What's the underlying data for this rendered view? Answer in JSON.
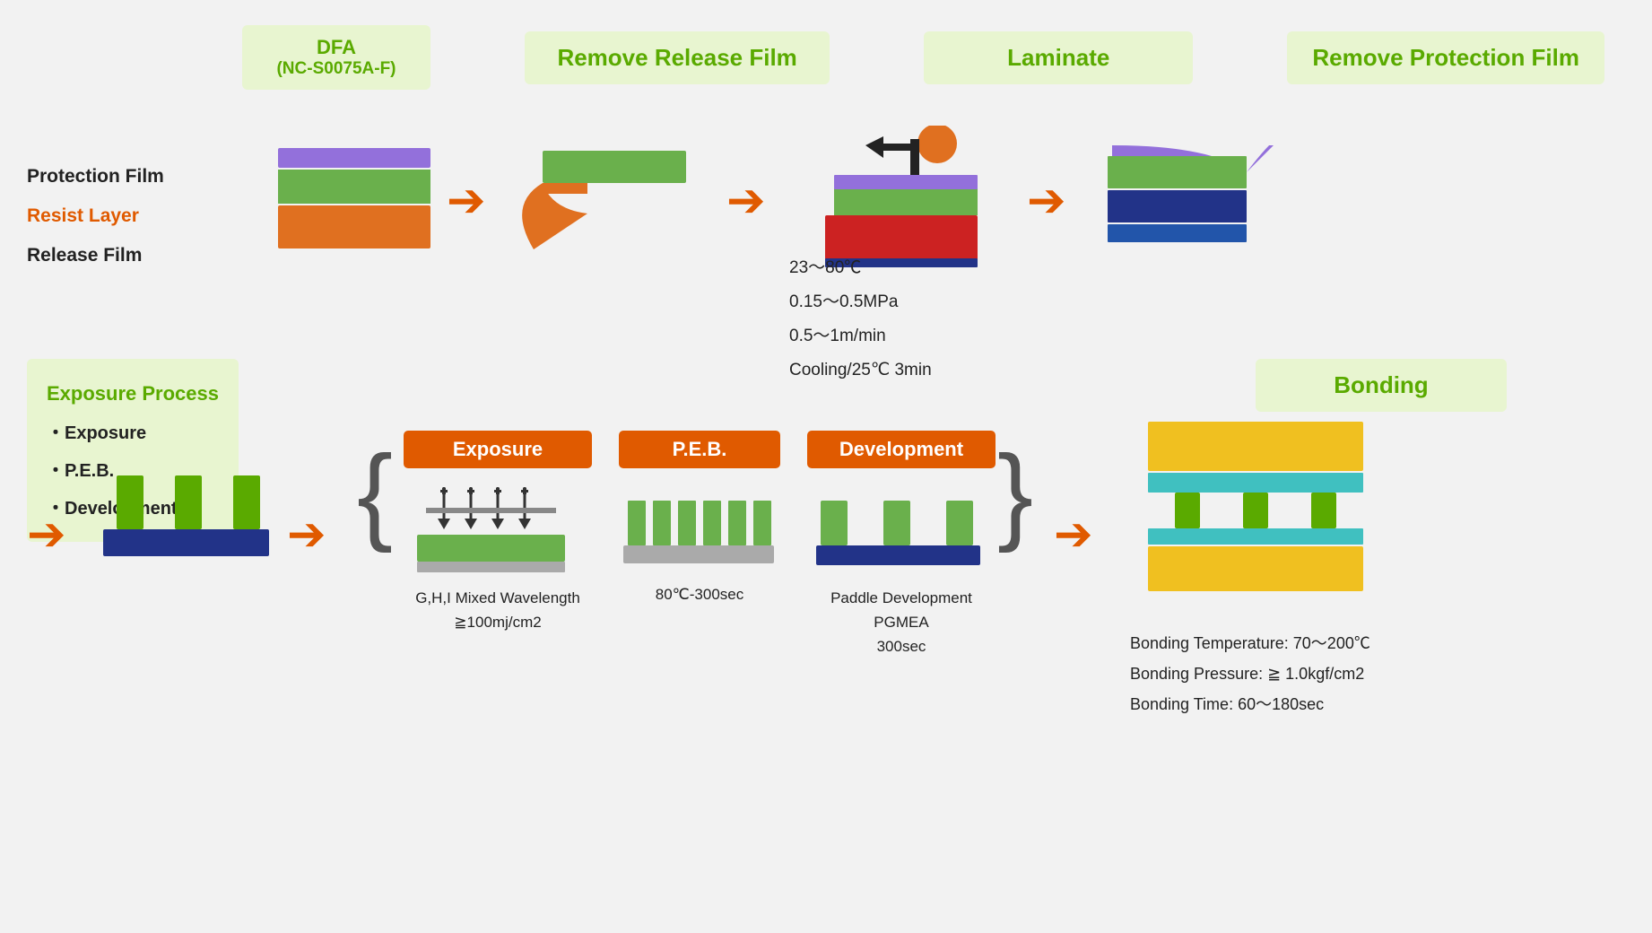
{
  "header": {
    "dfa_label": "DFA",
    "dfa_sub": "(NC-S0075A-F)",
    "remove_release_label": "Remove Release Film",
    "laminate_label": "Laminate",
    "remove_protection_label": "Remove Protection Film"
  },
  "legend": {
    "protection": "Protection Film",
    "resist": "Resist Layer",
    "release": "Release Film"
  },
  "laminate_conditions": {
    "temp": "23～80℃",
    "pressure": "0.15～0.5MPa",
    "speed": "0.5～1m/min",
    "cooling": "Cooling/25℃ 3min"
  },
  "exposure_process": {
    "title": "Exposure Process",
    "items": [
      "・Exposure",
      "・P.E.B.",
      "・Development"
    ]
  },
  "process_boxes": {
    "exposure": "Exposure",
    "peb": "P.E.B.",
    "development": "Development"
  },
  "exposure_detail": {
    "label": "G,H,I Mixed Wavelength\n≧100mj/cm2"
  },
  "peb_detail": {
    "label": "80℃-300sec"
  },
  "dev_detail": {
    "label": "Paddle Development\nPGMEA\n300sec"
  },
  "bonding": {
    "label": "Bonding",
    "temp": "Bonding Temperature: 70～200℃",
    "pressure": "Bonding Pressure: ≧ 1.0kgf/cm2",
    "time": "Bonding Time: 60～180sec"
  },
  "colors": {
    "green_label": "#5aaa00",
    "green_bg": "#e8f5d0",
    "orange_arrow": "#e05a00",
    "orange_box": "#e05a00",
    "purple": "#9370db",
    "green_layer": "#6ab04c",
    "orange_layer": "#e07020",
    "blue_layer": "#2255cc",
    "yellow_layer": "#f0c020",
    "cyan_layer": "#40c0c0",
    "red_substrate": "#cc2222",
    "dark_blue": "#223388"
  }
}
